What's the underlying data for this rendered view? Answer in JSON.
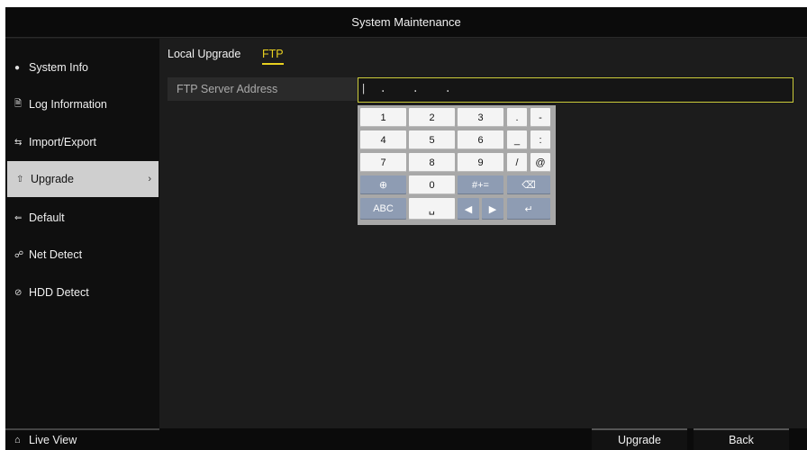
{
  "window": {
    "title": "System Maintenance"
  },
  "sidebar": {
    "items": [
      {
        "label": "System Info",
        "icon": "info-dot-icon"
      },
      {
        "label": "Log Information",
        "icon": "log-icon"
      },
      {
        "label": "Import/Export",
        "icon": "import-export-icon"
      },
      {
        "label": "Upgrade",
        "icon": "upgrade-icon",
        "active": true
      },
      {
        "label": "Default",
        "icon": "default-icon"
      },
      {
        "label": "Net Detect",
        "icon": "net-detect-icon"
      },
      {
        "label": "HDD Detect",
        "icon": "hdd-detect-icon"
      }
    ],
    "live_view": "Live View"
  },
  "tabs": [
    {
      "label": "Local Upgrade"
    },
    {
      "label": "FTP",
      "active": true
    }
  ],
  "ftp": {
    "label": "FTP Server Address",
    "value": "|  .    .    ."
  },
  "keypad": {
    "row1": [
      "1",
      "2",
      "3",
      ".",
      "-"
    ],
    "row2": [
      "4",
      "5",
      "6",
      "_",
      ":"
    ],
    "row3": [
      "7",
      "8",
      "9",
      "/",
      "@"
    ],
    "row4": [
      "0",
      "#+="
    ],
    "row5": [
      "ABC"
    ]
  },
  "buttons": {
    "upgrade": "Upgrade",
    "back": "Back"
  },
  "colors": {
    "accent": "#e8d020",
    "input_border": "#cbcb3a",
    "keypad_dark": "#8e9cb3"
  }
}
